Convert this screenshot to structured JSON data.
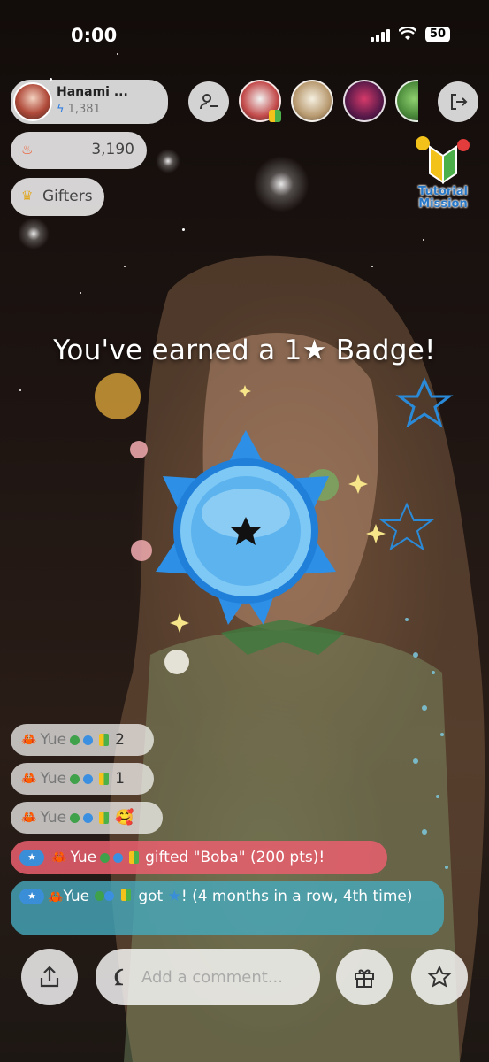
{
  "status_bar": {
    "time": "0:00",
    "battery": "50"
  },
  "host": {
    "name": "Hanami ...",
    "points": "1,381"
  },
  "score": {
    "value": "3,190"
  },
  "gifters": {
    "label": "Gifters"
  },
  "tutorial": {
    "line1": "Tutorial",
    "line2": "Mission"
  },
  "badge_message": "You've earned a 1★ Badge!",
  "chat": {
    "username": "Yue",
    "rows": [
      {
        "text": "2"
      },
      {
        "text": "1"
      },
      {
        "text": "🥰"
      }
    ],
    "gift_message": "gifted \"Boba\" (200 pts)!",
    "sub_message_a": "got",
    "sub_message_b": "! (4 months in a row, 4th time)"
  },
  "comment": {
    "placeholder": "Add a comment..."
  },
  "icons": {
    "host_avatar": "avatar",
    "points": "lightning-icon",
    "score": "flame-icon",
    "gifters": "crown-icon",
    "follow": "person-remove-icon",
    "exit": "exit-icon",
    "share": "share-icon",
    "comment": "speech-bubble-icon",
    "gift": "gift-icon",
    "favorite": "star-icon",
    "badge": "star-badge-icon"
  },
  "colors": {
    "badge_blue": "#3aa0f0",
    "gift_row": "#ea5f6e",
    "sub_row": "#46aabe"
  }
}
